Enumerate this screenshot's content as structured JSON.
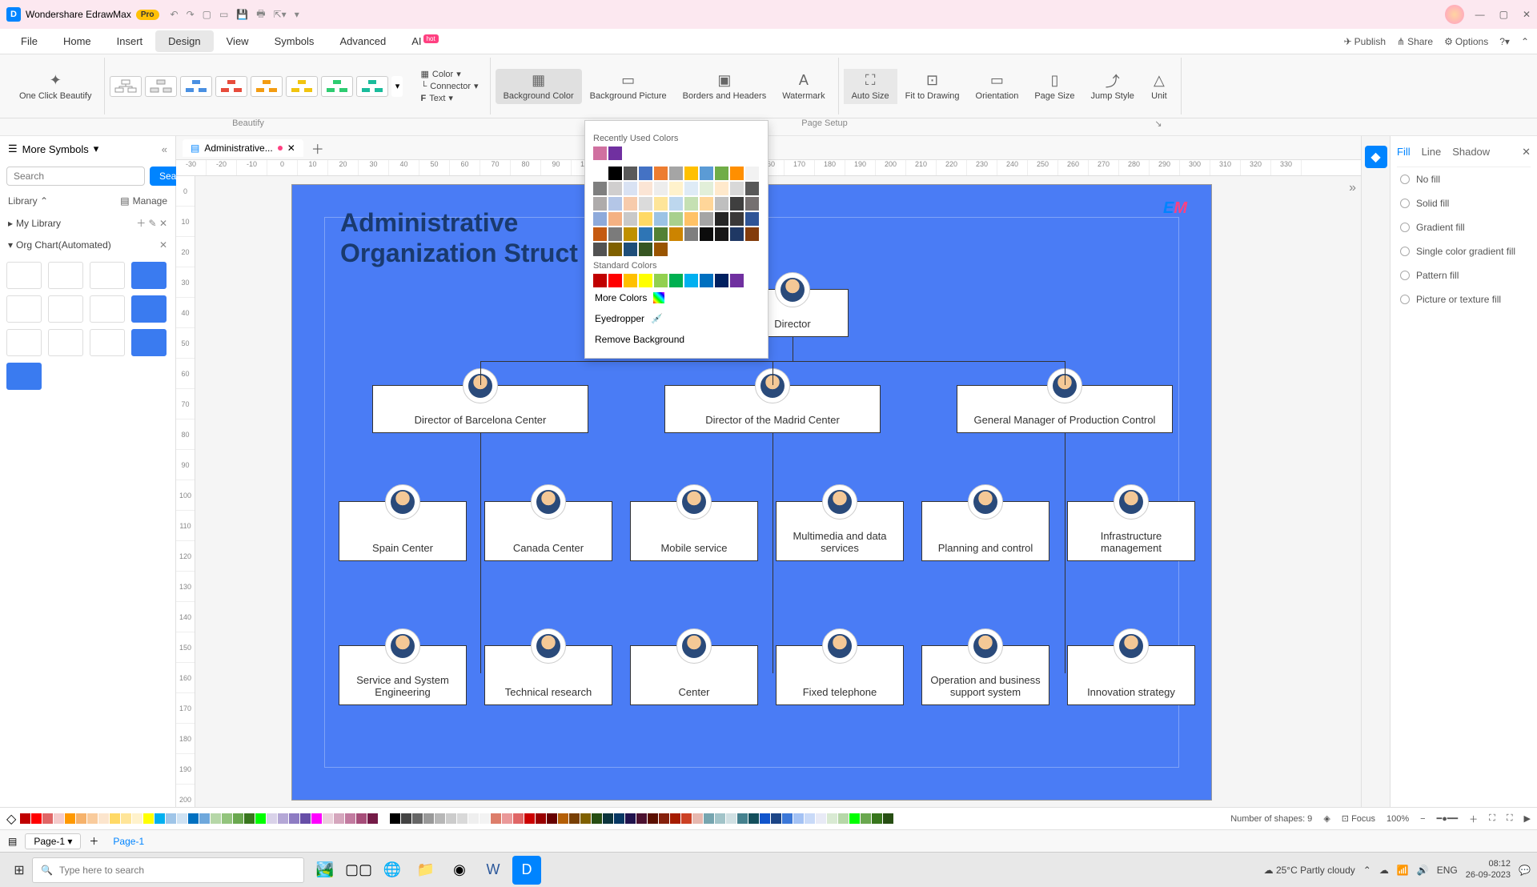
{
  "title": "Wondershare EdrawMax",
  "pro": "Pro",
  "menu": [
    "File",
    "Home",
    "Insert",
    "Design",
    "View",
    "Symbols",
    "Advanced",
    "AI"
  ],
  "menuRight": {
    "publish": "Publish",
    "share": "Share",
    "options": "Options"
  },
  "ribbon": {
    "oneclick": "One Click Beautify",
    "color": "Color",
    "connector": "Connector",
    "text": "Text",
    "bgcolor": "Background Color",
    "bgpic": "Background Picture",
    "borders": "Borders and Headers",
    "watermark": "Watermark",
    "autosize": "Auto Size",
    "fit": "Fit to Drawing",
    "orient": "Orientation",
    "pagesize": "Page Size",
    "jump": "Jump Style",
    "unit": "Unit"
  },
  "sectionLabels": {
    "beautify": "Beautify",
    "pagesetup": "Page Setup"
  },
  "left": {
    "hdr": "More Symbols",
    "search": "Search",
    "searchBtn": "Search",
    "library": "Library",
    "manage": "Manage",
    "mylib": "My Library",
    "orgchart": "Org Chart(Automated)"
  },
  "tab": {
    "name": "Administrative..."
  },
  "diagram": {
    "title1": "Administrative",
    "title2": "Organization Struct",
    "director": "Director",
    "l2": [
      "Director of Barcelona Center",
      "Director of the Madrid Center",
      "General Manager of Production Control"
    ],
    "l3": [
      "Spain Center",
      "Canada Center",
      "Mobile service",
      "Multimedia and data services",
      "Planning and control",
      "Infrastructure management"
    ],
    "l4": [
      "Service and System Engineering",
      "Technical research",
      "Center",
      "Fixed telephone",
      "Operation and business support system",
      "Innovation strategy"
    ]
  },
  "popup": {
    "recent": "Recently Used Colors",
    "standard": "Standard Colors",
    "more": "More Colors",
    "eyedrop": "Eyedropper",
    "remove": "Remove Background"
  },
  "right": {
    "tabs": [
      "Fill",
      "Line",
      "Shadow"
    ],
    "opts": [
      "No fill",
      "Solid fill",
      "Gradient fill",
      "Single color gradient fill",
      "Pattern fill",
      "Picture or texture fill"
    ]
  },
  "status": {
    "shapes": "Number of shapes: 9",
    "focus": "Focus",
    "zoom": "100%"
  },
  "pagebar": {
    "page": "Page-1",
    "tab": "Page-1"
  },
  "taskbar": {
    "search": "Type here to search",
    "weather": "25°C  Partly cloudy",
    "time": "08:12",
    "date": "26-09-2023"
  },
  "themeColors": [
    "#ffffff",
    "#000000",
    "#5a5a5a",
    "#4472c4",
    "#ed7d31",
    "#a5a5a5",
    "#ffc000",
    "#5b9bd5",
    "#70ad47",
    "#ff8f00"
  ],
  "themeTints": [
    [
      "#f2f2f2",
      "#7f7f7f",
      "#d0cece",
      "#d9e2f3",
      "#fbe5d5",
      "#ededed",
      "#fff2cc",
      "#deebf6",
      "#e2efd9",
      "#ffe9cc"
    ],
    [
      "#d8d8d8",
      "#595959",
      "#aeabab",
      "#b4c6e7",
      "#f7cbac",
      "#dbdbdb",
      "#fee599",
      "#bdd7ee",
      "#c5e0b3",
      "#ffd699"
    ],
    [
      "#bfbfbf",
      "#3f3f3f",
      "#757070",
      "#8eaadb",
      "#f4b183",
      "#c9c9c9",
      "#ffd965",
      "#9cc3e5",
      "#a8d08d",
      "#ffc266"
    ],
    [
      "#a5a5a5",
      "#262626",
      "#3a3838",
      "#2f5496",
      "#c55a11",
      "#7b7b7b",
      "#bf9000",
      "#2e75b5",
      "#538135",
      "#cc8400"
    ],
    [
      "#7f7f7f",
      "#0c0c0c",
      "#171616",
      "#1f3864",
      "#833c0b",
      "#525252",
      "#7f6000",
      "#1e4e79",
      "#375623",
      "#995400"
    ]
  ],
  "standardColors": [
    "#c00000",
    "#ff0000",
    "#ffc000",
    "#ffff00",
    "#92d050",
    "#00b050",
    "#00b0f0",
    "#0070c0",
    "#002060",
    "#7030a0"
  ],
  "recentColors": [
    "#d070a0",
    "#7030a0"
  ],
  "palette": [
    "#c00000",
    "#ff0000",
    "#e06666",
    "#f4cccc",
    "#ff9900",
    "#f6b26b",
    "#f9cb9c",
    "#fce5cd",
    "#ffd966",
    "#ffe599",
    "#fff2cc",
    "#ffff00",
    "#00b0f0",
    "#9fc5e8",
    "#cfe2f3",
    "#0070c0",
    "#6fa8dc",
    "#b6d7a8",
    "#93c47d",
    "#6aa84f",
    "#38761d",
    "#00ff00",
    "#d9d2e9",
    "#b4a7d6",
    "#8e7cc3",
    "#674ea7",
    "#ff00ff",
    "#ead1dc",
    "#d5a6bd",
    "#c27ba0",
    "#a64d79",
    "#741b47",
    "#ffffff",
    "#000000",
    "#434343",
    "#666666",
    "#999999",
    "#b7b7b7",
    "#cccccc",
    "#d9d9d9",
    "#efefef",
    "#f3f3f3",
    "#dd7e6b",
    "#ea9999",
    "#e06666",
    "#cc0000",
    "#990000",
    "#660000",
    "#b45f06",
    "#783f04",
    "#7f6000",
    "#274e13",
    "#0c343d",
    "#073763",
    "#20124d",
    "#4c1130",
    "#5b0f00",
    "#85200c",
    "#a61c00",
    "#cc4125",
    "#e6b8af",
    "#76a5af",
    "#a2c4c9",
    "#d0e0e3",
    "#45818e",
    "#134f5c",
    "#1155cc",
    "#1c4587",
    "#3c78d8",
    "#a4c2f4",
    "#c9daf8",
    "#e8eaf6",
    "#d9ead3",
    "#b6d7a8",
    "#00ff00",
    "#6aa84f",
    "#38761d",
    "#274e13"
  ]
}
